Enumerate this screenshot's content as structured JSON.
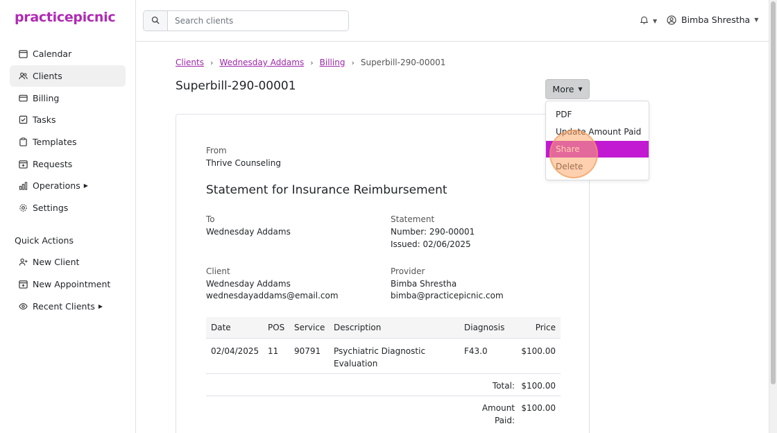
{
  "app": {
    "logo": "practicepicnic"
  },
  "sidebar": {
    "items": [
      {
        "label": "Calendar",
        "icon": "calendar-icon"
      },
      {
        "label": "Clients",
        "icon": "users-icon",
        "active": true
      },
      {
        "label": "Billing",
        "icon": "credit-card-icon"
      },
      {
        "label": "Tasks",
        "icon": "check-square-icon"
      },
      {
        "label": "Templates",
        "icon": "clipboard-icon"
      },
      {
        "label": "Requests",
        "icon": "calendar-plus-icon"
      },
      {
        "label": "Operations",
        "icon": "bar-chart-icon",
        "has_submenu": true
      },
      {
        "label": "Settings",
        "icon": "gear-icon"
      }
    ],
    "quick_actions_title": "Quick Actions",
    "quick_actions": [
      {
        "label": "New Client",
        "icon": "user-plus-icon"
      },
      {
        "label": "New Appointment",
        "icon": "calendar-plus-icon"
      },
      {
        "label": "Recent Clients",
        "icon": "eye-icon",
        "has_submenu": true
      }
    ]
  },
  "topbar": {
    "search_placeholder": "Search clients",
    "user_name": "Bimba Shrestha"
  },
  "breadcrumb": {
    "items": [
      "Clients",
      "Wednesday Addams",
      "Billing"
    ],
    "current": "Superbill-290-00001"
  },
  "page": {
    "title": "Superbill-290-00001",
    "more_label": "More"
  },
  "dropdown": {
    "items": [
      "PDF",
      "Update Amount Paid",
      "Share",
      "Delete"
    ],
    "highlighted": "Share"
  },
  "superbill": {
    "from_label": "From",
    "from_value": "Thrive Counseling",
    "title": "Statement for Insurance Reimbursement",
    "to_label": "To",
    "to_value": "Wednesday Addams",
    "statement_label": "Statement",
    "statement_number": "Number: 290-00001",
    "statement_issued": "Issued: 02/06/2025",
    "client_label": "Client",
    "client_name": "Wednesday Addams",
    "client_email": "wednesdayaddams@email.com",
    "provider_label": "Provider",
    "provider_name": "Bimba Shrestha",
    "provider_email": "bimba@practicepicnic.com",
    "table": {
      "headers": [
        "Date",
        "POS",
        "Service",
        "Description",
        "Diagnosis",
        "Price"
      ],
      "rows": [
        {
          "date": "02/04/2025",
          "pos": "11",
          "service": "90791",
          "description_line1": "Psychiatric Diagnostic",
          "description_line2": "Evaluation",
          "diagnosis": "F43.0",
          "price": "$100.00"
        }
      ],
      "total_label": "Total:",
      "total_value": "$100.00",
      "amount_paid_label_line1": "Amount",
      "amount_paid_label_line2": "Paid:",
      "amount_paid_value": "$100.00"
    }
  },
  "colors": {
    "brand": "#b02ab5",
    "link": "#9d27a8",
    "highlight": "#c21ad2"
  }
}
